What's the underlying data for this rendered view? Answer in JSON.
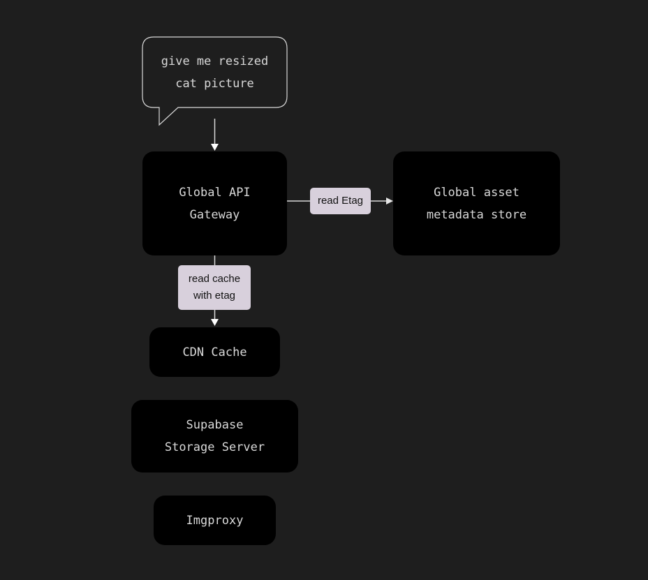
{
  "diagram": {
    "speech_bubble": {
      "lines": [
        "give me resized",
        "cat picture"
      ]
    },
    "nodes": {
      "api_gateway": {
        "lines": [
          "Global API",
          "Gateway"
        ]
      },
      "metadata_store": {
        "lines": [
          "Global asset",
          "metadata store"
        ]
      },
      "cdn_cache": {
        "lines": [
          "CDN Cache"
        ]
      },
      "storage_server": {
        "lines": [
          "Supabase",
          "Storage Server"
        ]
      },
      "imgproxy": {
        "lines": [
          "Imgproxy"
        ]
      }
    },
    "edges": {
      "read_etag": {
        "lines": [
          "read Etag"
        ]
      },
      "read_cache": {
        "lines": [
          "read cache",
          "with etag"
        ]
      }
    },
    "colors": {
      "background": "#1e1e1e",
      "node_fill": "#000000",
      "node_text": "#d9d9d9",
      "edge_label_fill": "#d8d0dc",
      "edge_line": "#d9d9d9"
    }
  }
}
